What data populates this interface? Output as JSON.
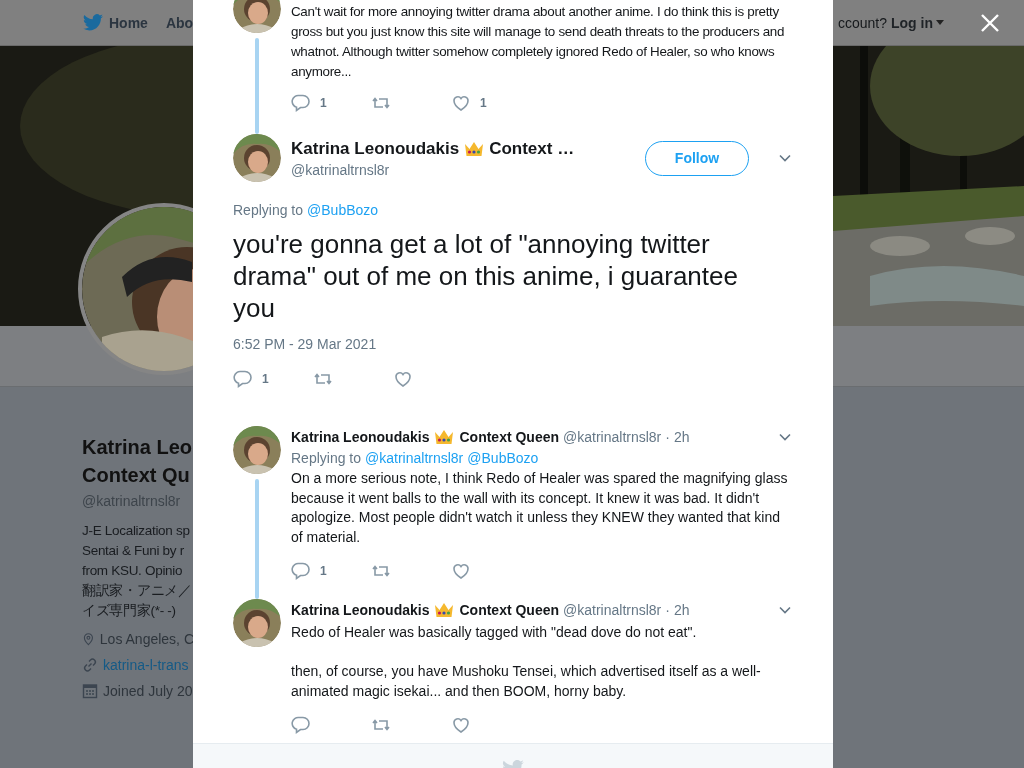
{
  "nav": {
    "items": [
      {
        "label": "Home",
        "kind": "home"
      },
      {
        "label": "Abo",
        "kind": "plain"
      }
    ],
    "account_prompt": "ccount?",
    "login": "Log in"
  },
  "profile": {
    "name_lines": [
      "Katrina Leo",
      "Context Qu"
    ],
    "handle": "@katrinaltrnsl8r",
    "bio_lines": [
      "J-E Localization sp",
      "Sentai & Funi by r",
      "from KSU. Opinio",
      "翻訳家・アニメ／",
      "イズ専門家(*- -)"
    ],
    "details": [
      {
        "kind": "location",
        "text": "Los Angeles, C"
      },
      {
        "kind": "link",
        "text": "katrina-l-trans"
      },
      {
        "kind": "joined",
        "text": "Joined July 20"
      }
    ]
  },
  "thread": {
    "parent": {
      "text": "Can't wait for more annoying twitter drama about another anime. I do think this is pretty gross but you just know this site will manage to send death threats to the producers and whatnot. Although twitter somehow completely ignored Redo of Healer, so who knows anymore...",
      "actions": [
        {
          "kind": "reply",
          "count": "1"
        },
        {
          "kind": "retweet"
        },
        {
          "kind": "like",
          "count": "1"
        }
      ]
    },
    "main": {
      "name": "Katrina Leonoudakis",
      "name_rest": "Context …",
      "handle": "@katrinaltrnsl8r",
      "follow": "Follow",
      "replying_label": "Replying to",
      "mentions": [
        "@BubBozo"
      ],
      "text": "you're gonna get a lot of \"annoying twitter drama\" out of me on this anime, i guarantee you",
      "timestamp": "6:52 PM - 29 Mar 2021",
      "actions": [
        {
          "kind": "reply",
          "count": "1"
        },
        {
          "kind": "retweet"
        },
        {
          "kind": "like"
        }
      ]
    },
    "replies": [
      {
        "name": "Katrina Leonoudakis",
        "name_rest": "Context Queen",
        "handle": "@katrinaltrnsl8r",
        "separator": "·",
        "time": "2h",
        "replying_label": "Replying to",
        "mentions": [
          "@katrinaltrnsl8r",
          "@BubBozo"
        ],
        "paragraphs": [
          "On a more serious note, I think Redo of Healer was spared the magnifying glass because it went balls to the wall with its concept. It knew it was bad. It didn't apologize. Most people didn't watch it unless they KNEW they wanted that kind of material."
        ],
        "actions": [
          {
            "kind": "reply",
            "count": "1"
          },
          {
            "kind": "retweet"
          },
          {
            "kind": "like"
          }
        ],
        "thread_line": true
      },
      {
        "name": "Katrina Leonoudakis",
        "name_rest": "Context Queen",
        "handle": "@katrinaltrnsl8r",
        "separator": "·",
        "time": "2h",
        "paragraphs": [
          "Redo of Healer was basically tagged with \"dead dove do not eat\".",
          "then, of course, you have Mushoku Tensei, which advertised itself as a well-animated magic isekai... and then BOOM, horny baby."
        ],
        "actions": [
          {
            "kind": "reply"
          },
          {
            "kind": "retweet"
          },
          {
            "kind": "like"
          }
        ],
        "thread_line": false
      }
    ]
  }
}
